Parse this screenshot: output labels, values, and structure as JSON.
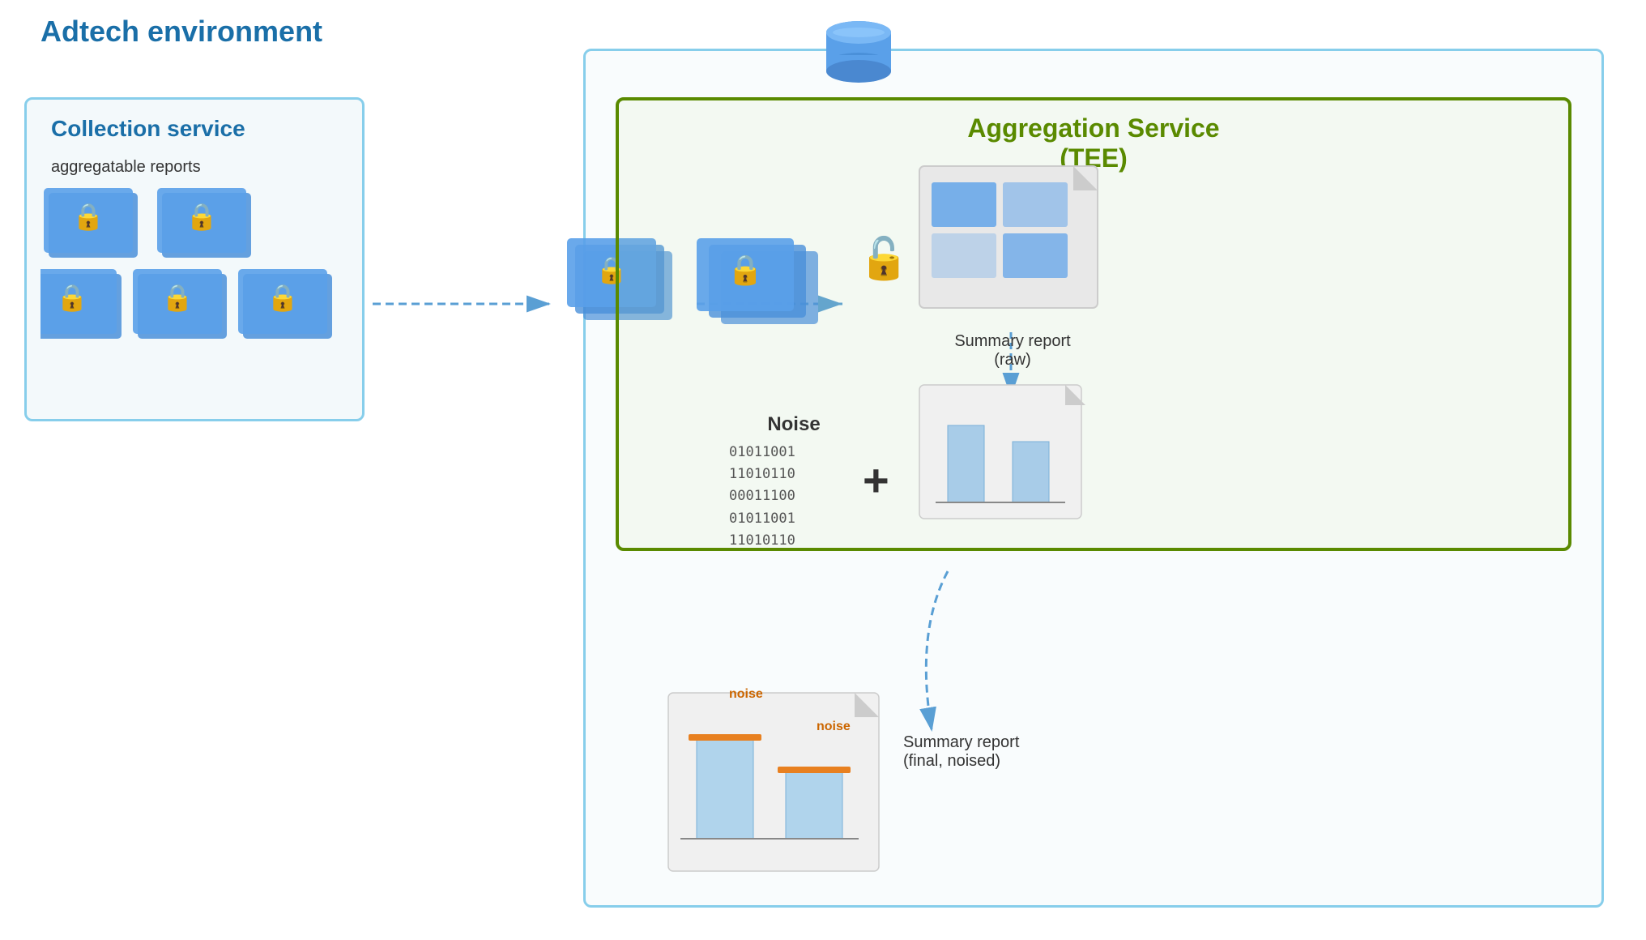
{
  "adtech": {
    "label": "Adtech environment"
  },
  "collection_service": {
    "label": "Collection service",
    "sublabel": "aggregatable reports"
  },
  "aggregation_service": {
    "line1": "Aggregation Service",
    "line2": "(TEE)"
  },
  "summary_report_raw": {
    "label_line1": "Summary report",
    "label_line2": "(raw)"
  },
  "summary_report_final": {
    "label_line1": "Summary report",
    "label_line2": "(final, noised)"
  },
  "noise": {
    "label": "Noise",
    "binary_line1": "01011001",
    "binary_line2": "11010110",
    "binary_line3": "00011100",
    "binary_line4": "01011001",
    "binary_line5": "11010110"
  },
  "noise_annotations": {
    "noise1": "noise",
    "noise2": "noise"
  }
}
